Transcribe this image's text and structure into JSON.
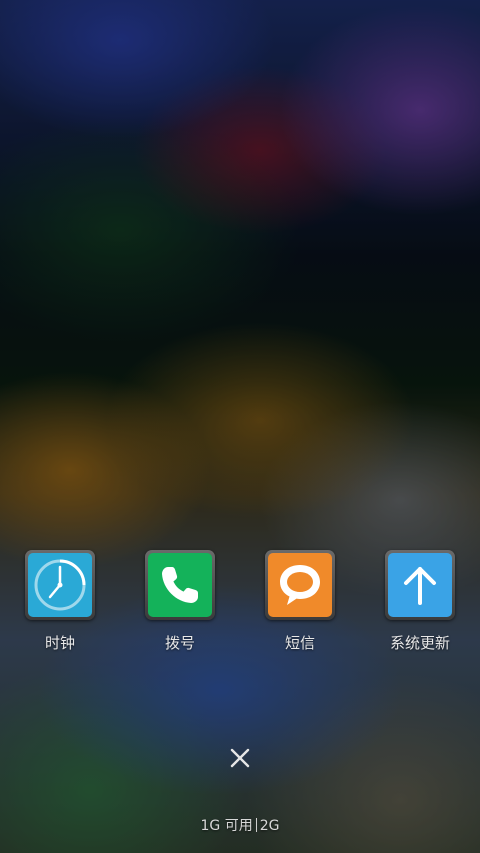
{
  "apps": [
    {
      "label": "时钟",
      "icon": "clock-icon",
      "color": "#2aa9d6"
    },
    {
      "label": "拨号",
      "icon": "phone-icon",
      "color": "#14b25a"
    },
    {
      "label": "短信",
      "icon": "message-bubble-icon",
      "color": "#f08a2a"
    },
    {
      "label": "系统更新",
      "icon": "arrow-up-icon",
      "color": "#3aa3e6"
    }
  ],
  "memory": {
    "available_text": "1G 可用",
    "total_text": "2G"
  },
  "close_icon": "close-icon"
}
